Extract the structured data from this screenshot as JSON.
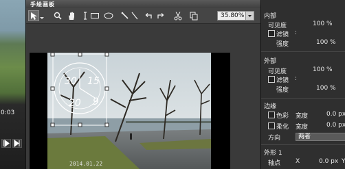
{
  "window": {
    "title": "手绘画板"
  },
  "left_preview": {
    "time_text": "0:03"
  },
  "toolbar": {
    "tools": [
      "arrow-select-icon",
      "magnifier-icon",
      "hand-pan-icon",
      "text-cursor-icon",
      "rectangle-icon",
      "ellipse-icon",
      "pen-icon",
      "line-icon",
      "undo-icon",
      "redo-icon",
      "cut-icon",
      "copy-icon"
    ],
    "zoom_value": "35.80%"
  },
  "photo": {
    "date_stamp": "2014.01.22",
    "clock_numbers": [
      "30",
      "15",
      "20",
      "9"
    ]
  },
  "panel": {
    "inner": {
      "heading": "内部",
      "visibility_label": "可见度",
      "visibility_value": "100 %",
      "filter_label": "滤镜",
      "filter_colon": ":",
      "strength_label": "强度",
      "strength_value": "100 %"
    },
    "outer": {
      "heading": "外部",
      "visibility_label": "可见度",
      "visibility_value": "100 %",
      "filter_label": "滤镜",
      "filter_colon": ":",
      "strength_label": "强度",
      "strength_value": "100 %"
    },
    "edge": {
      "heading": "边缘",
      "color_label": "色彩",
      "color_width_label": "宽度",
      "color_width_value": "0.0 px",
      "soft_label": "柔化",
      "soft_width_label": "宽度",
      "soft_width_value": "0.0 px",
      "direction_label": "方向",
      "direction_value": "两者"
    },
    "shape": {
      "heading": "外形 1",
      "axis_label": "轴点",
      "x_label": "X",
      "x_value": "0.0 px",
      "y_label": "Y"
    }
  }
}
